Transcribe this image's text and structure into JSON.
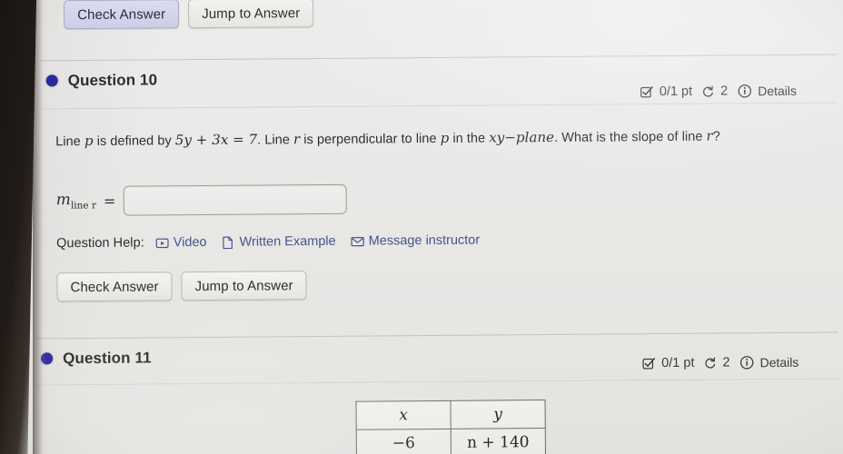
{
  "top_buttons": {
    "check_answer": "Check Answer",
    "jump_to_answer": "Jump to Answer"
  },
  "question10": {
    "title": "Question 10",
    "badge": {
      "points": "0/1 pt",
      "attempts": "2",
      "details": "Details",
      "checkbox_icon": "checkbox-check-icon",
      "retry_icon": "retry-circular-arrow-icon",
      "info_icon": "info-circle-icon"
    },
    "prompt_part1": "Line ",
    "prompt_var_p": "p",
    "prompt_part2": " is defined by ",
    "equation": "5y + 3x = 7",
    "prompt_part3": ". Line ",
    "prompt_var_r": "r",
    "prompt_part4": " is perpendicular to line ",
    "prompt_var_p2": "p",
    "prompt_part5": " in the ",
    "plane": "xy−plane",
    "prompt_part6": ". What is the slope of line ",
    "prompt_var_r2": "r",
    "prompt_part7": "?",
    "answer_label_m": "m",
    "answer_label_sub": "line r",
    "answer_equals": "=",
    "answer_value": "",
    "answer_placeholder": "",
    "help_label": "Question Help:",
    "help_links": [
      {
        "label": "Video",
        "icon": "video-play-icon"
      },
      {
        "label": "Written Example",
        "icon": "document-page-icon"
      },
      {
        "label": "Message instructor",
        "icon": "envelope-icon"
      }
    ],
    "check_answer": "Check Answer",
    "jump_to_answer": "Jump to Answer"
  },
  "question11": {
    "title": "Question 11",
    "badge": {
      "points": "0/1 pt",
      "attempts": "2",
      "details": "Details",
      "checkbox_icon": "checkbox-check-icon",
      "retry_icon": "retry-circular-arrow-icon",
      "info_icon": "info-circle-icon"
    },
    "table": {
      "headers": [
        "x",
        "y"
      ],
      "rows": [
        [
          "−6",
          "n + 140"
        ]
      ]
    }
  },
  "colors": {
    "bullet": "#2a2a9c",
    "link": "#41548f",
    "page_bg": "#e9e8e6",
    "focus_button": "#cdcde6"
  }
}
